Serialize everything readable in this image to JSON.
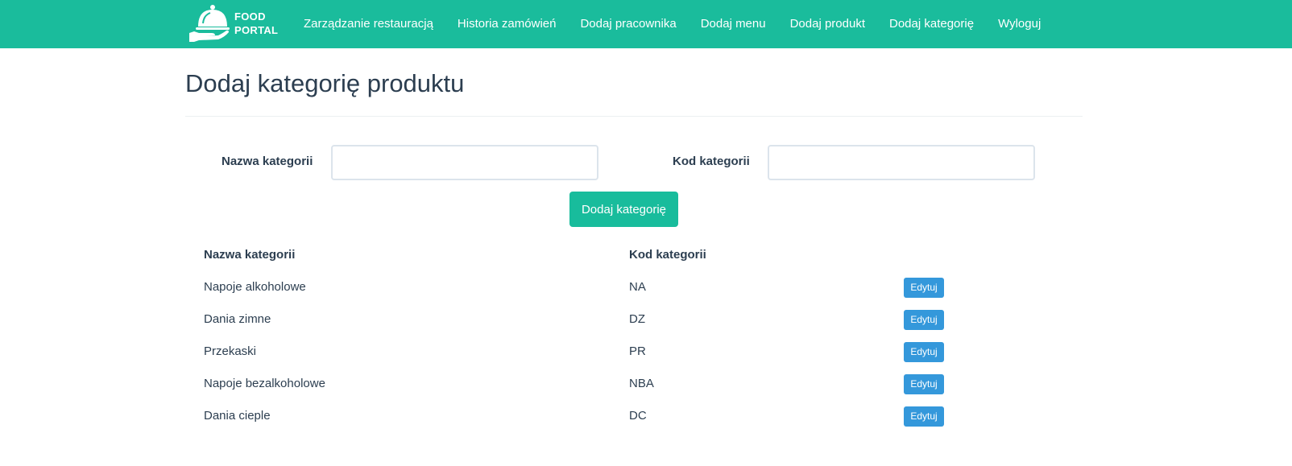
{
  "brand": {
    "line1": "FOOD",
    "line2": "PORTAL"
  },
  "nav": [
    {
      "label": "Zarządzanie restauracją"
    },
    {
      "label": "Historia zamówień"
    },
    {
      "label": "Dodaj pracownika"
    },
    {
      "label": "Dodaj menu"
    },
    {
      "label": "Dodaj produkt"
    },
    {
      "label": "Dodaj kategorię"
    },
    {
      "label": "Wyloguj"
    }
  ],
  "page": {
    "title": "Dodaj kategorię produktu"
  },
  "form": {
    "name_label": "Nazwa kategorii",
    "name_value": "",
    "code_label": "Kod kategorii",
    "code_value": "",
    "submit_label": "Dodaj kategorię"
  },
  "table": {
    "headers": {
      "name": "Nazwa kategorii",
      "code": "Kod kategorii"
    },
    "edit_label": "Edytuj",
    "rows": [
      {
        "name": "Napoje alkoholowe",
        "code": "NA"
      },
      {
        "name": "Dania zimne",
        "code": "DZ"
      },
      {
        "name": "Przekaski",
        "code": "PR"
      },
      {
        "name": "Napoje bezalkoholowe",
        "code": "NBA"
      },
      {
        "name": "Dania cieple",
        "code": "DC"
      }
    ]
  },
  "colors": {
    "navbar": "#1abc9c",
    "primary_button": "#18bc9c",
    "edit_button": "#3498db",
    "text": "#2c3e50"
  },
  "icons": {
    "logo": "cloche-serving-hand-icon"
  }
}
